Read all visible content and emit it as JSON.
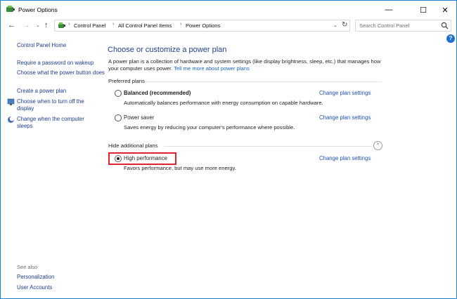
{
  "window": {
    "title": "Power Options",
    "minimize_glyph": "—",
    "maximize_glyph": "☐",
    "close_glyph": "✕"
  },
  "nav": {
    "back_glyph": "←",
    "forward_glyph": "→",
    "dropdown_glyph": "⌄",
    "up_glyph": "↑",
    "breadcrumbs": [
      "Control Panel",
      "All Control Panel Items",
      "Power Options"
    ],
    "breadcrumb_sep": "›",
    "refresh_glyph": "↻"
  },
  "search": {
    "placeholder": "Search Control Panel"
  },
  "help": {
    "glyph": "?"
  },
  "sidebar": {
    "home": "Control Panel Home",
    "links": [
      "Require a password on wakeup",
      "Choose what the power button does",
      "Create a power plan",
      "Choose when to turn off the display",
      "Change when the computer sleeps"
    ],
    "see_also_title": "See also",
    "see_also": [
      "Personalization",
      "User Accounts"
    ]
  },
  "main": {
    "heading": "Choose or customize a power plan",
    "description": "A power plan is a collection of hardware and system settings (like display brightness, sleep, etc.) that manages how your computer uses power.",
    "learn_more": "Tell me more about power plans",
    "preferred_title": "Preferred plans",
    "additional_title": "Hide additional plans",
    "collapse_glyph": "⌃",
    "change_link": "Change plan settings",
    "plans": [
      {
        "name": "Balanced (recommended)",
        "desc": "Automatically balances performance with energy consumption on capable hardware.",
        "selected": false
      },
      {
        "name": "Power saver",
        "desc": "Saves energy by reducing your computer's performance where possible.",
        "selected": false
      },
      {
        "name": "High performance",
        "desc": "Favors performance, but may use more energy.",
        "selected": true
      }
    ]
  },
  "colors": {
    "link": "#1a3c8c",
    "heading": "#1f3f8f",
    "highlight": "#e0232a"
  }
}
